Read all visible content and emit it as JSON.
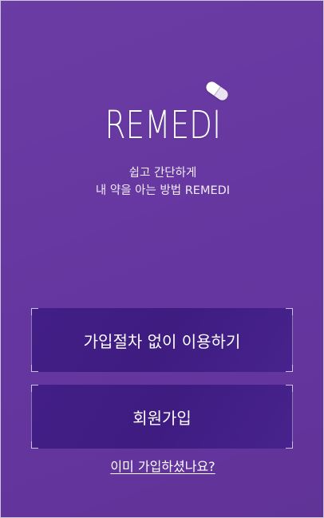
{
  "app": {
    "logo_text": "REMEDI",
    "tagline_line1": "쉽고 간단하게",
    "tagline_line2": "내 약을 아는 방법 REMEDI"
  },
  "actions": {
    "guest_label": "가입절차 없이 이용하기",
    "signup_label": "회원가입",
    "login_link_label": "이미 가입하셨나요?"
  },
  "colors": {
    "background": "#6636a0",
    "button": "#421f86",
    "text": "#ffffff"
  },
  "icons": {
    "logo_mark": "pill-icon"
  }
}
